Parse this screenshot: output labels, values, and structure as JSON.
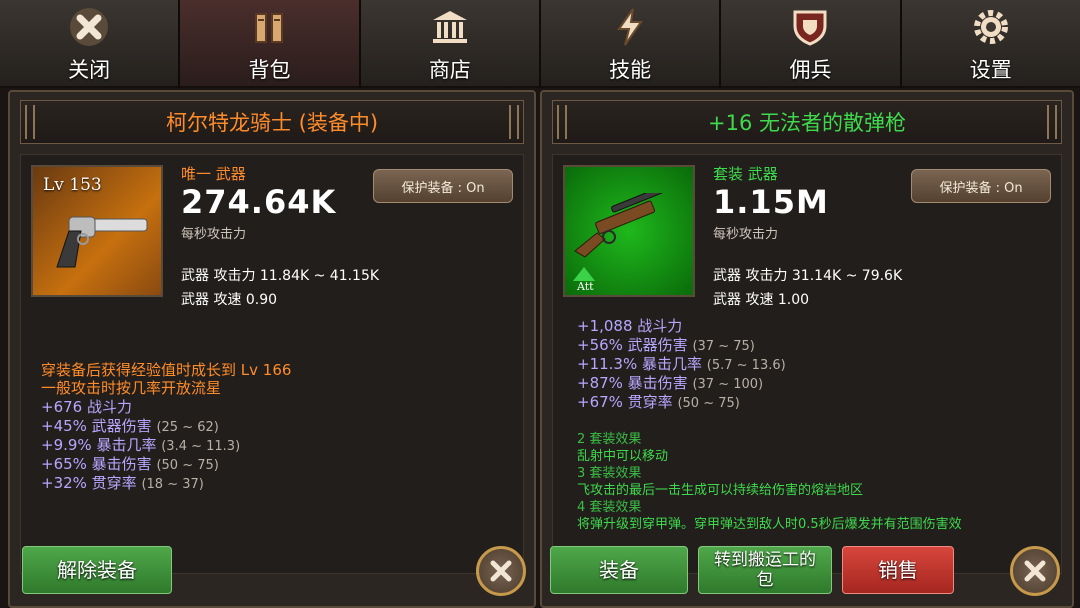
{
  "nav": [
    {
      "label": "关闭",
      "icon": "close-icon"
    },
    {
      "label": "背包",
      "icon": "backpack-icon",
      "active": true
    },
    {
      "label": "商店",
      "icon": "shop-icon"
    },
    {
      "label": "技能",
      "icon": "lightning-icon"
    },
    {
      "label": "佣兵",
      "icon": "shield-icon"
    },
    {
      "label": "设置",
      "icon": "gear-icon"
    }
  ],
  "left_panel": {
    "title": "柯尔特龙骑士 (装备中)",
    "title_color": "#ff8c2a",
    "level": "Lv 153",
    "rarity": "唯一 武器",
    "rarity_color": "#ff8c2a",
    "power": "274.64K",
    "power_label": "每秒攻击力",
    "attack": "武器 攻击力 11.84K ~ 41.15K",
    "speed": "武器 攻速 0.90",
    "protect": "保护装备 : On",
    "special": [
      "穿装备后获得经验值时成长到 Lv 166",
      "一般攻击时按几率开放流星"
    ],
    "bonuses": [
      {
        "text": "+676 战斗力",
        "range": ""
      },
      {
        "text": "+45% 武器伤害",
        "range": "(25 ~ 62)"
      },
      {
        "text": "+9.9% 暴击几率",
        "range": "(3.4 ~ 11.3)"
      },
      {
        "text": "+65% 暴击伤害",
        "range": "(50 ~ 75)"
      },
      {
        "text": "+32% 贯穿率",
        "range": "(18 ~ 37)"
      }
    ],
    "unequip_label": "解除装备"
  },
  "right_panel": {
    "title": "+16 无法者的散弹枪",
    "title_color": "#3ed94c",
    "att_label": "Att",
    "rarity": "套装 武器",
    "rarity_color": "#3ed94c",
    "power": "1.15M",
    "power_label": "每秒攻击力",
    "attack": "武器 攻击力 31.14K ~ 79.6K",
    "speed": "武器 攻速 1.00",
    "protect": "保护装备 : On",
    "bonuses": [
      {
        "text": "+1,088 战斗力",
        "range": ""
      },
      {
        "text": "+56% 武器伤害",
        "range": "(37 ~ 75)"
      },
      {
        "text": "+11.3% 暴击几率",
        "range": "(5.7 ~ 13.6)"
      },
      {
        "text": "+87% 暴击伤害",
        "range": "(37 ~ 100)"
      },
      {
        "text": "+67% 贯穿率",
        "range": "(50 ~ 75)"
      }
    ],
    "set_effects": [
      "2 套装效果",
      "乱射中可以移动",
      "3 套装效果",
      "飞攻击的最后一击生成可以持续给伤害的熔岩地区",
      "4 套装效果",
      "将弹升级到穿甲弹。穿甲弹达到敌人时0.5秒后爆发并有范围伤害效"
    ],
    "equip_label": "装备",
    "transfer_label": "转到搬运工的包",
    "sell_label": "销售"
  },
  "colors": {
    "purple": "#b6a7ff",
    "orange": "#ff8c2a",
    "green": "#3ed94c"
  }
}
